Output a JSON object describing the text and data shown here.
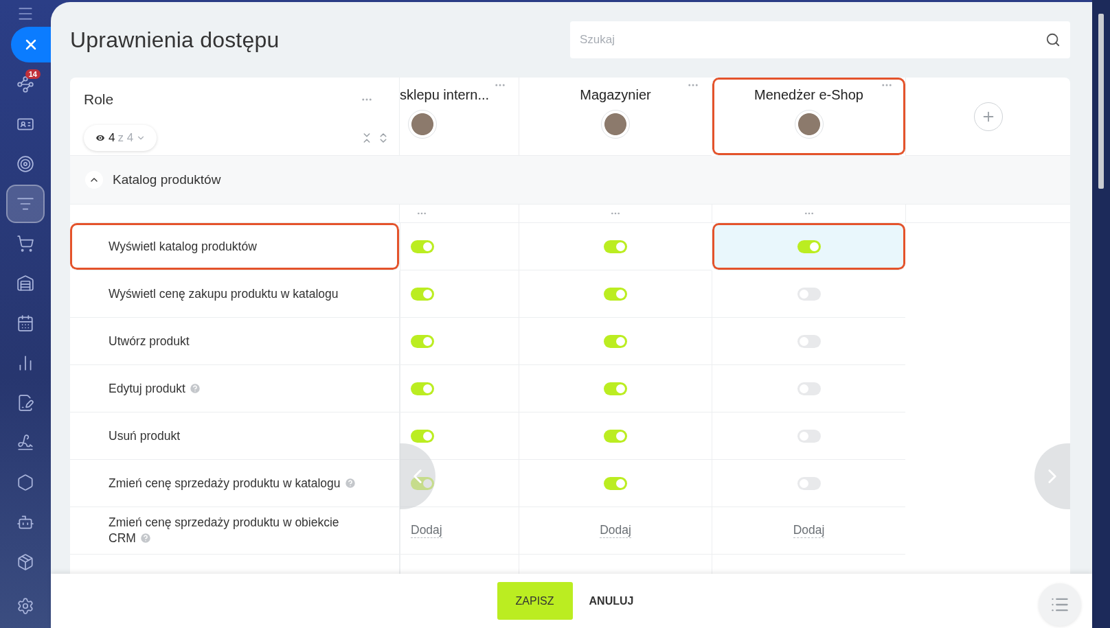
{
  "sidebar": {
    "items": [
      {
        "kind": "menu",
        "selected": false
      },
      {
        "kind": "close",
        "selected": false
      },
      {
        "kind": "flow",
        "selected": false,
        "badge": "14"
      },
      {
        "kind": "contacts",
        "selected": false
      },
      {
        "kind": "target",
        "selected": false
      },
      {
        "kind": "funnel",
        "selected": true
      },
      {
        "kind": "cart",
        "selected": false
      },
      {
        "kind": "store",
        "selected": false
      },
      {
        "kind": "calendar",
        "selected": false
      },
      {
        "kind": "chart",
        "selected": false
      },
      {
        "kind": "document",
        "selected": false
      },
      {
        "kind": "pen",
        "selected": false
      },
      {
        "kind": "hexagon",
        "selected": false
      },
      {
        "kind": "robot",
        "selected": false
      },
      {
        "kind": "box",
        "selected": false
      },
      {
        "kind": "settings",
        "selected": false
      }
    ]
  },
  "title": "Uprawnienia dostępu",
  "search": {
    "placeholder": "Szukaj"
  },
  "table": {
    "role_header": "Role",
    "filter": {
      "shown": "4",
      "total": "z 4"
    },
    "roles": [
      {
        "name": "sklepu intern...",
        "highlighted": false
      },
      {
        "name": "Magazynier",
        "highlighted": false
      },
      {
        "name": "Menedżer e-Shop",
        "highlighted": true
      }
    ],
    "section": {
      "title": "Katalog produktów",
      "expanded": true
    },
    "rows": [
      {
        "label": "Wyświetl katalog produktów",
        "help": false,
        "highlighted": true,
        "cells": [
          {
            "kind": "toggle",
            "on": true,
            "highlighted": false
          },
          {
            "kind": "toggle",
            "on": true,
            "highlighted": false
          },
          {
            "kind": "toggle",
            "on": true,
            "highlighted": true
          }
        ]
      },
      {
        "label": "Wyświetl cenę zakupu produktu w katalogu",
        "help": false,
        "highlighted": false,
        "cells": [
          {
            "kind": "toggle",
            "on": true,
            "highlighted": false
          },
          {
            "kind": "toggle",
            "on": true,
            "highlighted": false
          },
          {
            "kind": "toggle",
            "on": false,
            "highlighted": false
          }
        ]
      },
      {
        "label": "Utwórz produkt",
        "help": false,
        "highlighted": false,
        "cells": [
          {
            "kind": "toggle",
            "on": true,
            "highlighted": false
          },
          {
            "kind": "toggle",
            "on": true,
            "highlighted": false
          },
          {
            "kind": "toggle",
            "on": false,
            "highlighted": false
          }
        ]
      },
      {
        "label": "Edytuj produkt",
        "help": true,
        "highlighted": false,
        "cells": [
          {
            "kind": "toggle",
            "on": true,
            "highlighted": false
          },
          {
            "kind": "toggle",
            "on": true,
            "highlighted": false
          },
          {
            "kind": "toggle",
            "on": false,
            "highlighted": false
          }
        ]
      },
      {
        "label": "Usuń produkt",
        "help": false,
        "highlighted": false,
        "cells": [
          {
            "kind": "toggle",
            "on": true,
            "highlighted": false
          },
          {
            "kind": "toggle",
            "on": true,
            "highlighted": false
          },
          {
            "kind": "toggle",
            "on": false,
            "highlighted": false
          }
        ]
      },
      {
        "label": "Zmień cenę sprzedaży produktu w katalogu",
        "help": true,
        "highlighted": false,
        "cells": [
          {
            "kind": "toggle",
            "on": true,
            "highlighted": false
          },
          {
            "kind": "toggle",
            "on": true,
            "highlighted": false
          },
          {
            "kind": "toggle",
            "on": false,
            "highlighted": false
          }
        ]
      },
      {
        "label": "Zmień cenę sprzedaży produktu w obiekcie CRM",
        "help": true,
        "highlighted": false,
        "cells": [
          {
            "kind": "add",
            "label": "Dodaj",
            "highlighted": false
          },
          {
            "kind": "add",
            "label": "Dodaj",
            "highlighted": false
          },
          {
            "kind": "add",
            "label": "Dodaj",
            "highlighted": false
          }
        ]
      }
    ]
  },
  "footer": {
    "save": "ZAPISZ",
    "cancel": "ANULUJ"
  }
}
